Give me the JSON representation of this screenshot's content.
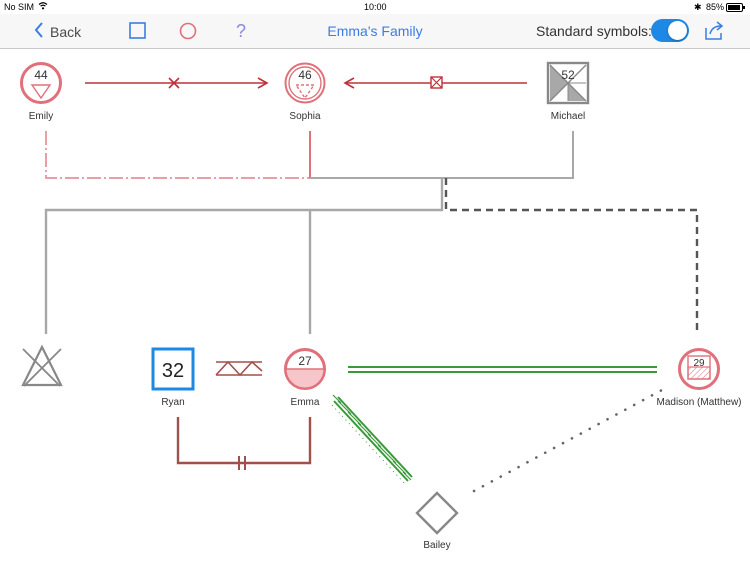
{
  "status": {
    "carrier": "No SIM",
    "time": "10:00",
    "battery": "85%"
  },
  "nav": {
    "back_label": "Back",
    "title": "Emma's Family",
    "standard_symbols_label": "Standard symbols:",
    "standard_symbols_on": true,
    "question_glyph": "?"
  },
  "colors": {
    "accent": "#3b7de0",
    "female": "#e0707a",
    "partner": "#c0303a",
    "male_blue": "#1e88e5",
    "friend_green": "#3a9a3a",
    "line_gray": "#a8a8a8"
  },
  "people": {
    "emily": {
      "name": "Emily",
      "age": "44"
    },
    "sophia": {
      "name": "Sophia",
      "age": "46"
    },
    "michael": {
      "name": "Michael",
      "age": "52"
    },
    "ryan": {
      "name": "Ryan",
      "age": "32"
    },
    "emma": {
      "name": "Emma",
      "age": "27"
    },
    "madison": {
      "name": "Madison (Matthew)",
      "age": "29"
    },
    "bailey": {
      "name": "Bailey"
    }
  }
}
